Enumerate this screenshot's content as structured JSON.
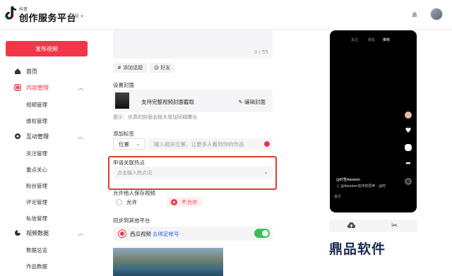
{
  "header": {
    "logo_small": "抖音",
    "logo_text": "创作服务平台",
    "switch_label": "切换 ▾"
  },
  "sidebar": {
    "publish_label": "发布视频",
    "items": [
      {
        "label": "首页"
      },
      {
        "label": "内容管理",
        "active": true
      },
      {
        "label": "视频管理"
      },
      {
        "label": "维权管理"
      },
      {
        "label": "互动管理"
      },
      {
        "label": "关注管理"
      },
      {
        "label": "重点关心"
      },
      {
        "label": "粉丝管理"
      },
      {
        "label": "评论管理"
      },
      {
        "label": "私信管理"
      },
      {
        "label": "视频数据"
      },
      {
        "label": "数据总览"
      },
      {
        "label": "作品数据"
      }
    ]
  },
  "main": {
    "char_count": "0 / 55",
    "chips": [
      "# 添加话题",
      "@ 好友"
    ],
    "cover_title": "设置封面",
    "cover_text": "支持完整视频封面截取",
    "cover_edit": "✎ 编辑封面",
    "hint": "提示：优质的封面会极大增加同城曝光",
    "tag_title": "添加标签",
    "tag_select": "位置",
    "tag_placeholder": "输入相关位置，让更多人看到你的作品",
    "hot_title": "申请关联热点",
    "hot_placeholder": "点击输入热点词",
    "save_title": "允许他人保存视频",
    "allow": "允许",
    "disallow": "不允许",
    "sync_title": "同步到其他平台",
    "sync_platform": "西瓜视频",
    "sync_link": "去绑定帐号"
  },
  "preview": {
    "tabs": "推荐",
    "tabs_left": "关注",
    "tabs_mid": "朋友",
    "author": "@时雪Awaken",
    "music": "♫ @Awaken创作的原声 · @时",
    "bottom": "首页"
  },
  "colors": {
    "accent": "#f2364a",
    "highlight_border": "#e23b2e",
    "toggle_on": "#35c05a"
  },
  "watermark": "鼎品软件"
}
